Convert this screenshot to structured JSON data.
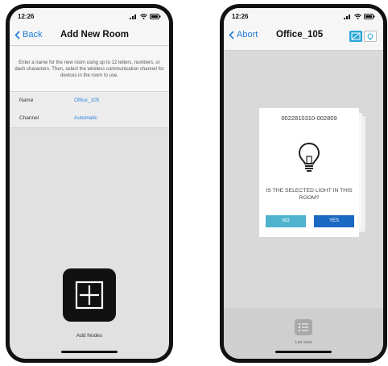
{
  "left_screen": {
    "status": {
      "time": "12:26"
    },
    "nav": {
      "back_label": "Back",
      "title": "Add New Room"
    },
    "instructions": "Enter a name for the new room using up to 12 letters, numbers, or dash characters. Then, select the wireless communication channel for devices in the room to use.",
    "rows": [
      {
        "label": "Name",
        "value": "Office_105"
      },
      {
        "label": "Channel",
        "value": "Automatic"
      }
    ],
    "add_nodes_label": "Add Nodes"
  },
  "right_screen": {
    "status": {
      "time": "12:26"
    },
    "nav": {
      "abort_label": "Abort",
      "title": "Office_105"
    },
    "card": {
      "serial": "0022810310-002809",
      "question": "IS THE SELECTED LIGHT IN THIS ROOM?",
      "no_label": "NO",
      "yes_label": "YES"
    },
    "list_view_label": "List view"
  },
  "colors": {
    "accent_blue": "#1e7ad9",
    "yes_button": "#1a69c2",
    "no_button": "#4fb3ce",
    "view_toggle_active": "#2aa7d8"
  }
}
